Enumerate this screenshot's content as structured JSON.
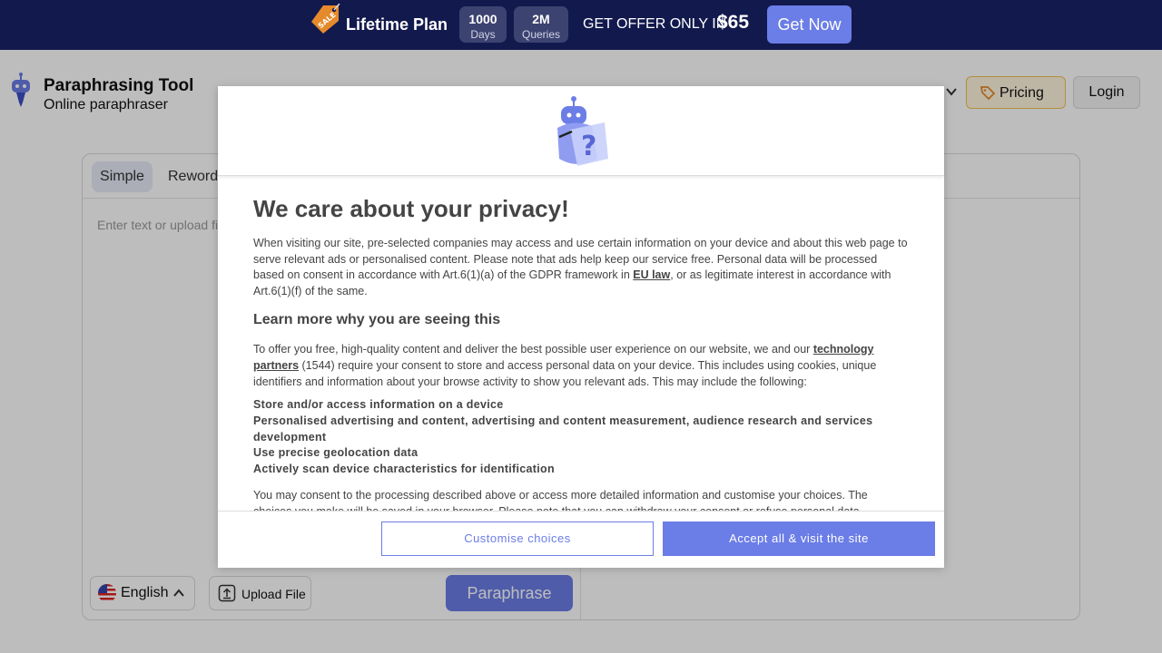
{
  "promo": {
    "plan": "Lifetime Plan",
    "days_value": "1000",
    "days_label": "Days",
    "queries_value": "2M",
    "queries_label": "Queries",
    "offer_text": "GET OFFER ONLY IN",
    "price": "$65",
    "cta": "Get Now",
    "sale_tag": "SALE"
  },
  "header": {
    "title": "Paraphrasing Tool",
    "subtitle": "Online paraphraser",
    "pricing": "Pricing",
    "login": "Login"
  },
  "editor": {
    "tabs": [
      {
        "label": "Simple"
      },
      {
        "label": "Rewordes"
      }
    ],
    "placeholder": "Enter text or upload fi",
    "language": "English",
    "upload": "Upload File",
    "paraphrase": "Paraphrase"
  },
  "consent": {
    "title": "We care about your privacy!",
    "intro_before_link": "When visiting our site, pre-selected companies may access and use certain information on your device and about this web page to serve relevant ads or personalised content. Please note that ads help keep our service free. Personal data will be processed based on consent in accordance with Art.6(1)(a) of the GDPR framework in ",
    "intro_link": "EU law",
    "intro_after_link": ", or as legitimate interest in accordance with Art.6(1)(f) of the same.",
    "learn_heading": "Learn more why you are seeing this",
    "partners_before_link": "To offer you free, high-quality content and deliver the best possible user experience on our website, we and our ",
    "partners_link": "technology partners",
    "partners_after_link": " (1544) require your consent to store and access personal data on your device. This includes using cookies, unique identifiers and information about your browse activity to show you relevant ads. This may include the following:",
    "purposes": [
      "Store and/or access information on a device",
      "Personalised advertising and content, advertising and content measurement, audience research and services development",
      "Use precise geolocation data",
      "Actively scan device characteristics for identification"
    ],
    "more_text": "You may consent to the processing described above or access more detailed information and customise your choices. The choices you make will be saved in your browser. Please note that you can withdraw your consent or refuse personal data processing at any time.",
    "customise": "Customise choices",
    "accept": "Accept all & visit the site"
  },
  "colors": {
    "promo_bg": "#12194d",
    "accent": "#6b7de6",
    "pricing_border": "#f2c14e"
  }
}
